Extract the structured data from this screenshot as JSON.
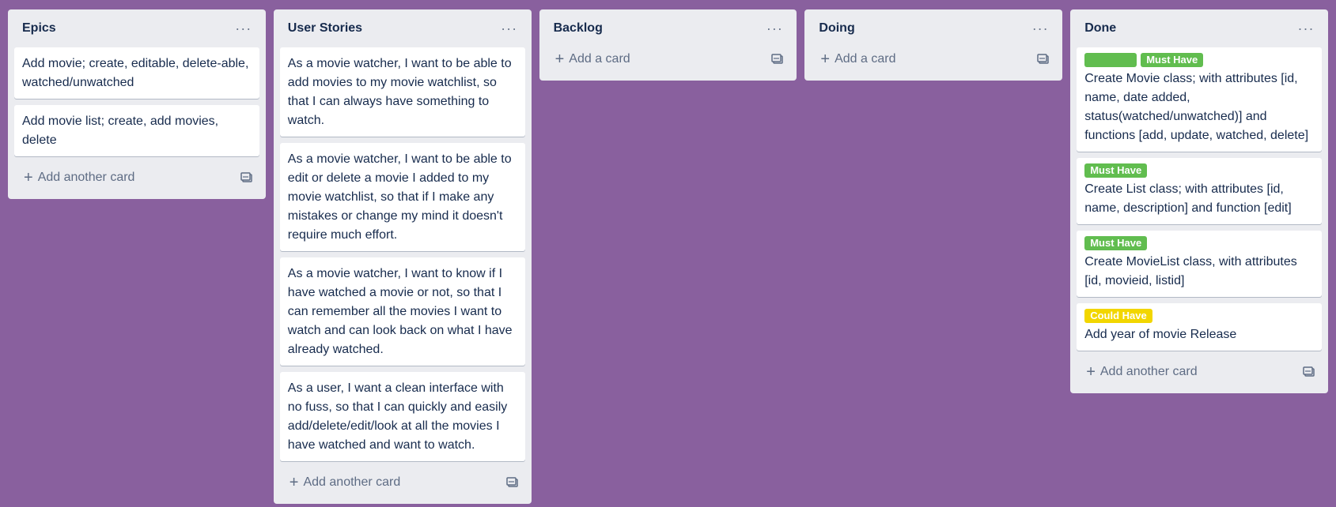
{
  "colors": {
    "board_bg": "#89609e",
    "list_bg": "#ebecf0",
    "card_bg": "#ffffff",
    "label_green": "#61bd4f",
    "label_yellow": "#f2d600"
  },
  "lists": [
    {
      "title": "Epics",
      "menu_icon": "more-horizontal-icon",
      "add_label": "Add another card",
      "cards": [
        {
          "text": "Add movie; create, editable, delete-able, watched/unwatched"
        },
        {
          "text": "Add movie list; create, add movies, delete"
        }
      ]
    },
    {
      "title": "User Stories",
      "menu_icon": "more-horizontal-icon",
      "add_label": "Add another card",
      "cards": [
        {
          "text": "As a movie watcher, I want to be able to add movies to my movie watchlist, so that I can always have something to watch."
        },
        {
          "text": "As a movie watcher, I want to be able to edit or delete a movie I added to my movie watchlist, so that if I make any mistakes or change my mind it doesn't require much effort."
        },
        {
          "text": "As a movie watcher, I want to know if I have watched a movie or not, so that I can remember all the movies I want to watch and can look back on what I have already watched."
        },
        {
          "text": "As a user, I want a clean interface with no fuss, so that I can quickly and easily add/delete/edit/look at all the movies I have watched and want to watch."
        }
      ]
    },
    {
      "title": "Backlog",
      "menu_icon": "more-horizontal-icon",
      "add_label": "Add a card",
      "cards": []
    },
    {
      "title": "Doing",
      "menu_icon": "more-horizontal-icon",
      "add_label": "Add a card",
      "cards": []
    },
    {
      "title": "Done",
      "menu_icon": "more-horizontal-icon",
      "add_label": "Add another card",
      "cards": [
        {
          "labels": [
            {
              "text": "",
              "color": "#61bd4f"
            },
            {
              "text": "Must Have",
              "color": "#61bd4f"
            }
          ],
          "text": "Create Movie class; with attributes [id, name, date added, status(watched/unwatched)] and functions [add, update, watched, delete]"
        },
        {
          "labels": [
            {
              "text": "Must Have",
              "color": "#61bd4f"
            }
          ],
          "text": "Create List class; with attributes [id, name, description] and function [edit]"
        },
        {
          "labels": [
            {
              "text": "Must Have",
              "color": "#61bd4f"
            }
          ],
          "text": "Create MovieList class, with attributes [id, movieid, listid]"
        },
        {
          "labels": [
            {
              "text": "Could Have",
              "color": "#f2d600"
            }
          ],
          "text": "Add year of movie Release"
        }
      ]
    }
  ]
}
